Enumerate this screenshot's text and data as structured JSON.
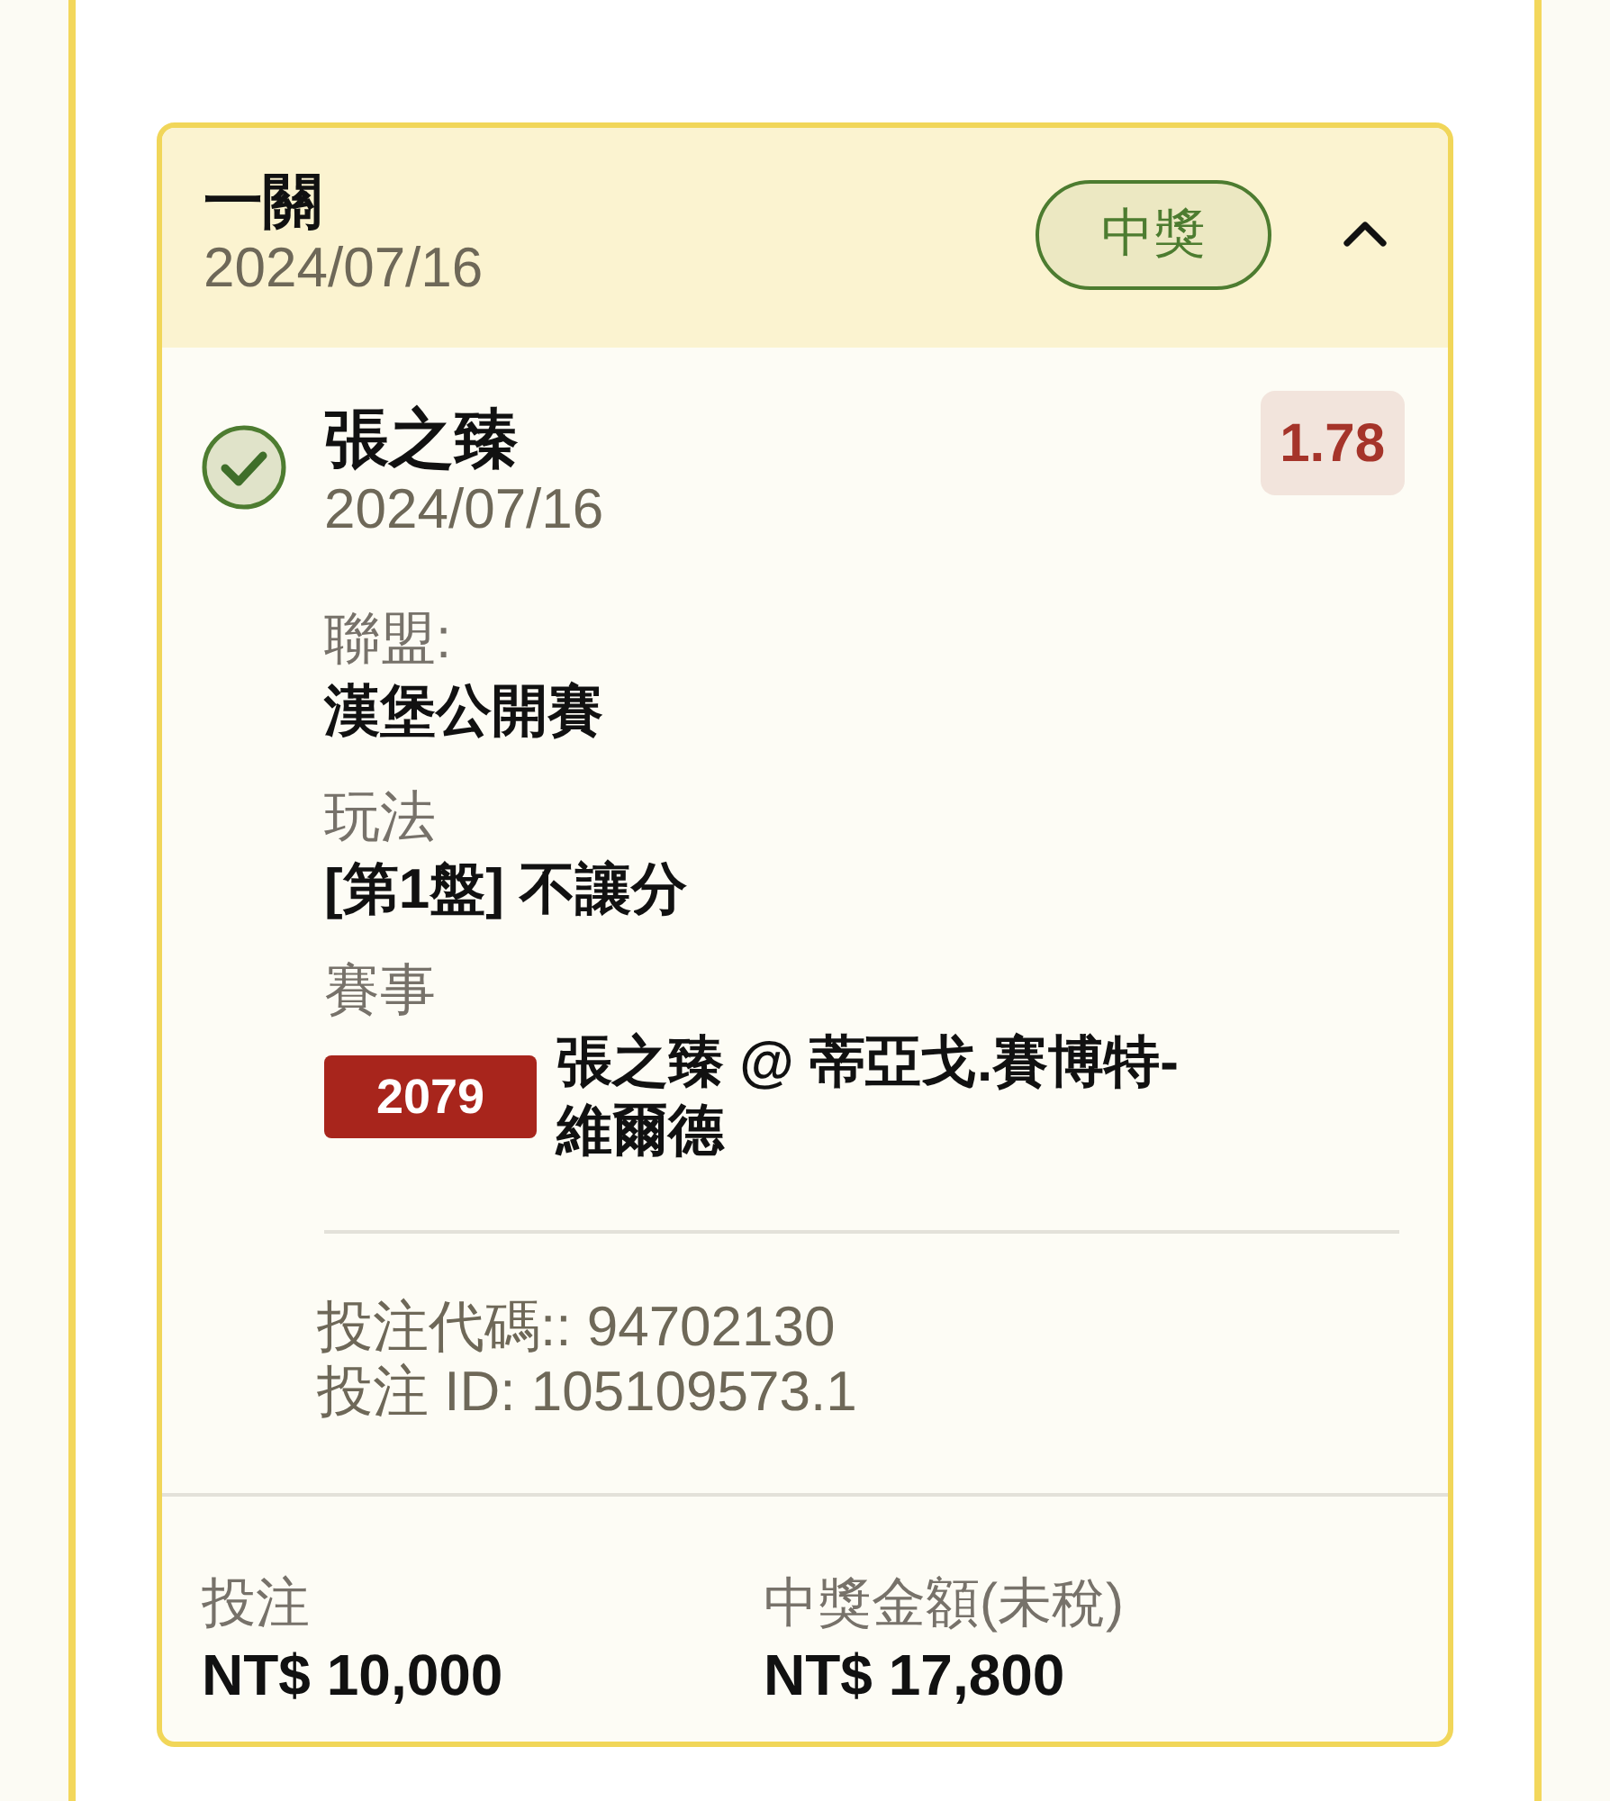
{
  "card": {
    "title": "一關",
    "date": "2024/07/16",
    "status": {
      "label": "中獎",
      "won": true
    },
    "expanded": true
  },
  "selections": [
    {
      "won": true,
      "name": "張之臻",
      "date": "2024/07/16",
      "odds": "1.78",
      "fields": [
        {
          "label": "聯盟:",
          "value": "漢堡公開賽"
        },
        {
          "label": "玩法",
          "value": "[第1盤] 不讓分"
        }
      ],
      "event": {
        "label": "賽事",
        "code": "2079",
        "name": "張之臻 @ 蒂亞戈.賽博特-維爾德"
      },
      "refs": [
        "投注代碼:: 94702130",
        "投注 ID: 105109573.1"
      ]
    }
  ],
  "totals": [
    {
      "label": "投注",
      "amount": "NT$ 10,000"
    },
    {
      "label": "中獎金額(未稅)",
      "amount": "NT$ 17,800"
    }
  ]
}
